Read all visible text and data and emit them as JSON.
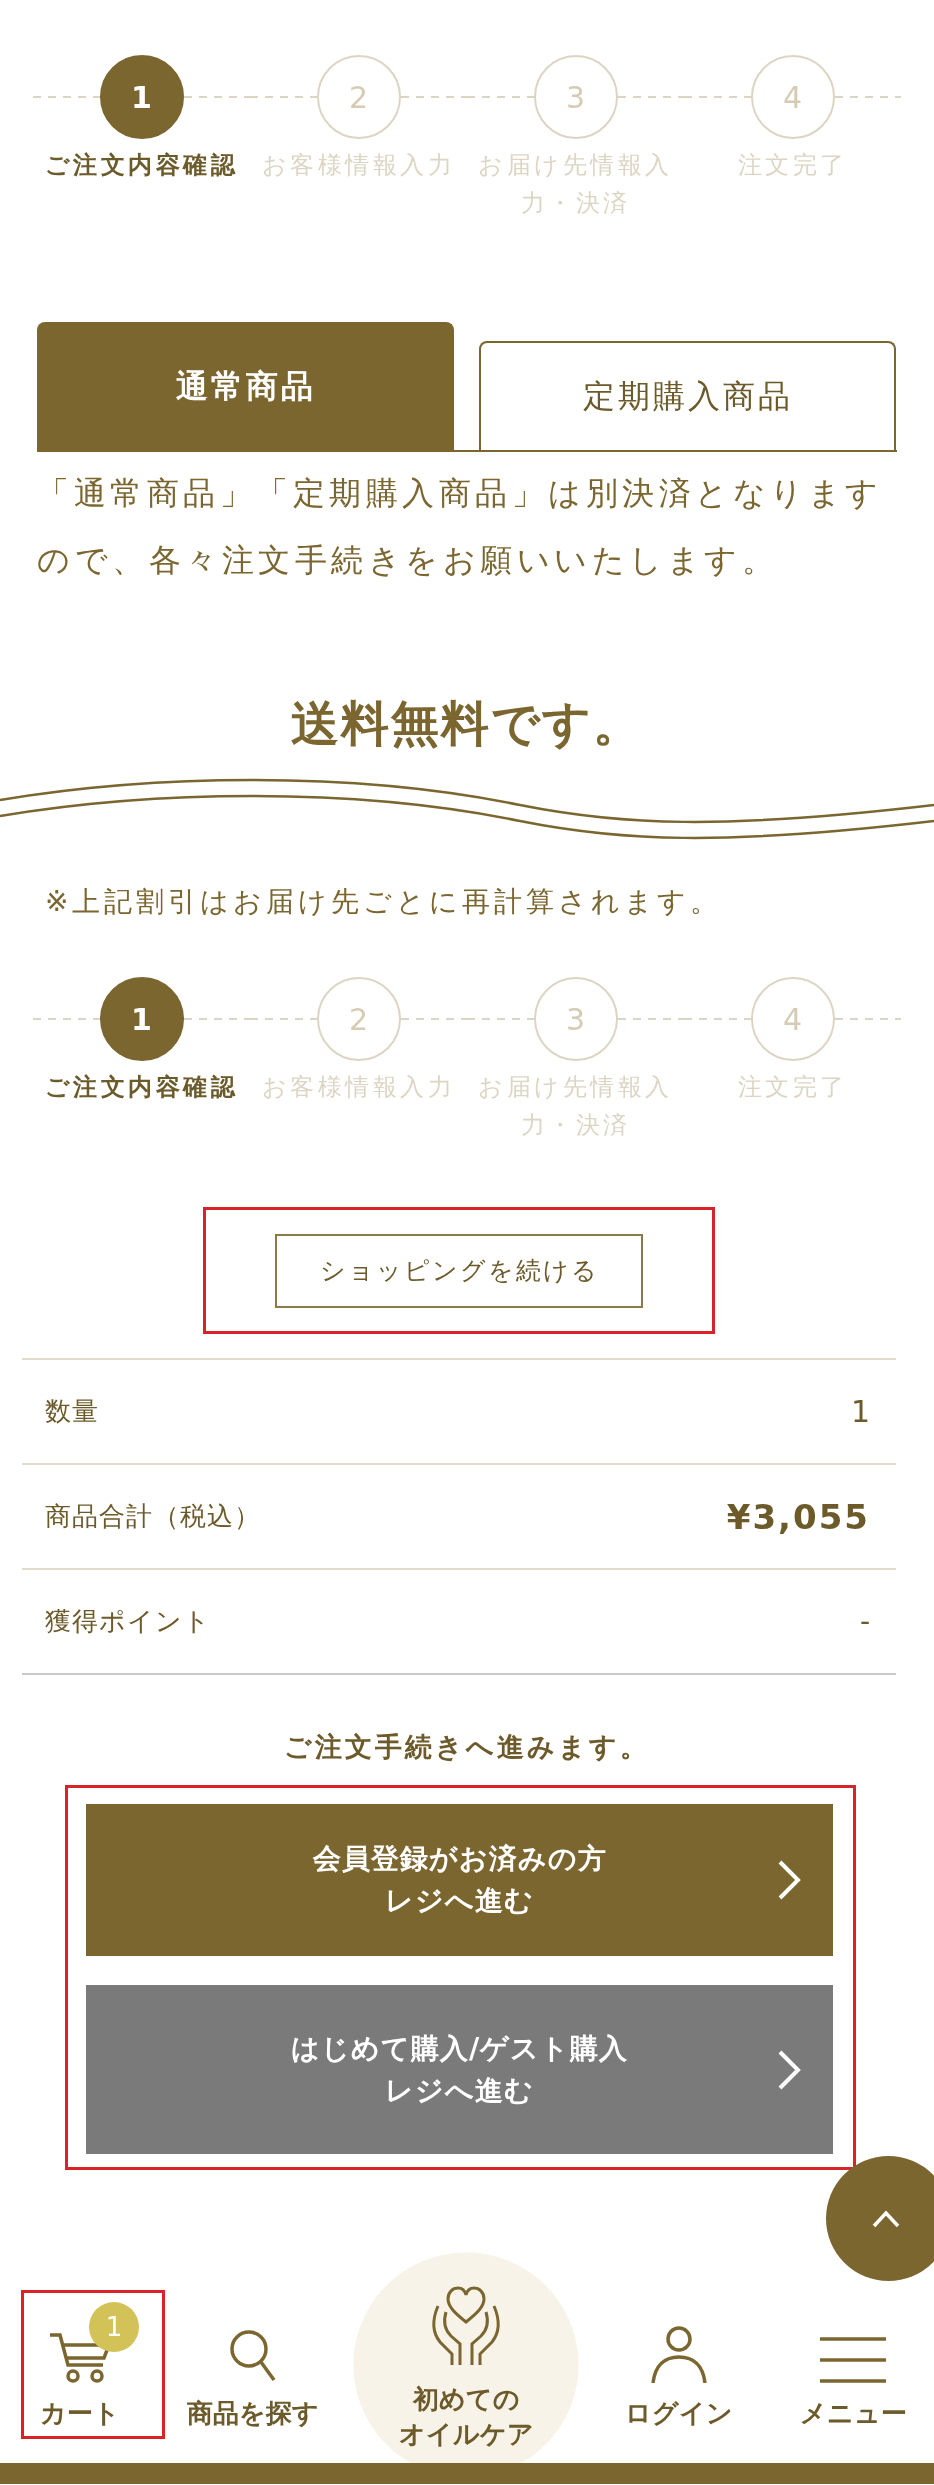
{
  "progress_top": {
    "steps": [
      {
        "number": "1",
        "label": "ご注文内容確認",
        "selected": true
      },
      {
        "number": "2",
        "label": "お客様情報入力",
        "selected": false
      },
      {
        "number": "3",
        "label": "お届け先情報入力・決済",
        "selected": false
      },
      {
        "number": "4",
        "label": "注文完了",
        "selected": false
      }
    ]
  },
  "tabs": [
    {
      "label": "通常商品",
      "selected": true
    },
    {
      "label": "定期購入商品",
      "selected": false
    }
  ],
  "notice": "「通常商品」「定期購入商品」は別決済となりますので、各々注文手続きをお願いいたします。",
  "banner": {
    "title": "送料無料です。"
  },
  "note": "※上記割引はお届け先ごとに再計算されます。",
  "progress_bottom": {
    "steps": [
      {
        "number": "1",
        "label": "ご注文内容確認",
        "selected": true
      },
      {
        "number": "2",
        "label": "お客様情報入力",
        "selected": false
      },
      {
        "number": "3",
        "label": "お届け先情報入力・決済",
        "selected": false
      },
      {
        "number": "4",
        "label": "注文完了",
        "selected": false
      }
    ]
  },
  "continue_button": {
    "label": "ショッピングを続ける",
    "highlighted": true
  },
  "summary": {
    "rows": [
      {
        "kind": "count",
        "label": "数量",
        "value": "1"
      },
      {
        "kind": "price",
        "label": "商品合計（税込）",
        "value": "¥3,055"
      },
      {
        "kind": "points",
        "label": "獲得ポイント",
        "value": "-"
      }
    ]
  },
  "checkout": {
    "heading": "ご注文手続きへ進みます。",
    "highlighted": true,
    "buttons": [
      {
        "kind": "member",
        "lines": [
          "会員登録がお済みの方",
          "レジへ進む"
        ]
      },
      {
        "kind": "guest",
        "lines": [
          "はじめて購入/ゲスト購入",
          "レジへ進む"
        ]
      }
    ]
  },
  "bottom_nav": {
    "items": [
      {
        "kind": "cart",
        "lines": [
          "カート"
        ],
        "badge": "1",
        "highlighted": true
      },
      {
        "kind": "search",
        "lines": [
          "商品を探す"
        ],
        "highlighted": false
      },
      {
        "kind": "featured",
        "lines": [
          "初めての",
          "オイルケア"
        ],
        "highlighted": false
      },
      {
        "kind": "login",
        "lines": [
          "ログイン"
        ],
        "highlighted": false
      },
      {
        "kind": "menu",
        "lines": [
          "メニュー"
        ],
        "highlighted": false
      }
    ]
  }
}
